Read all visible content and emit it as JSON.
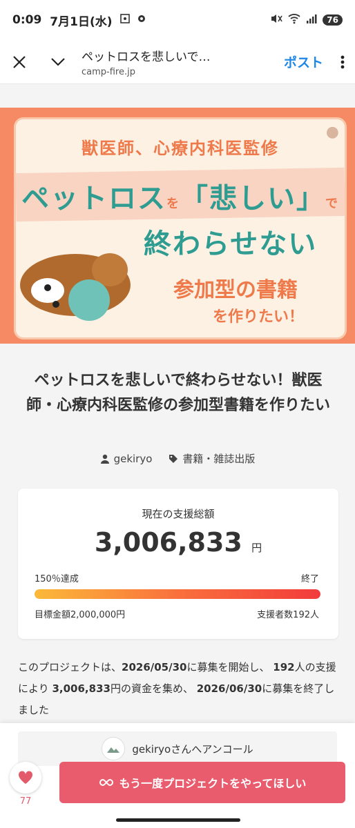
{
  "status_bar": {
    "time": "0:09",
    "date": "7月1日(水)",
    "battery": "76"
  },
  "browser": {
    "title": "ペットロスを悲しいで…",
    "url": "camp-fire.jp",
    "post_label": "ポスト"
  },
  "hero": {
    "subtitle": "獣医師、心療内科医監修",
    "line1a": "ペットロス",
    "line1b": "を",
    "line1c": "「悲しい」",
    "line1d": "で",
    "line2": "終わらせない",
    "line3": "参加型の書籍",
    "line4": "を作りたい！"
  },
  "project": {
    "title": "ペットロスを悲しいで終わらせない！獣医師・心療内科医監修の参加型書籍を作りたい",
    "owner": "gekiryo",
    "category": "書籍・雑誌出版"
  },
  "funding": {
    "label": "現在の支援総額",
    "amount": "3,006,833",
    "currency": "円",
    "percent_text": "150％達成",
    "percent": 150,
    "status": "終了",
    "goal_text": "目標金額2,000,000円",
    "backers_text": "支援者数192人"
  },
  "summary": {
    "p1": "このプロジェクトは、",
    "start": "2026/05/30",
    "p2": "に募集を開始し、",
    "backers": "192",
    "p3": "人の支援により",
    "amount": "3,006,833",
    "p4": "円の資金を集め、",
    "end": "2026/06/30",
    "p5": "に募集を終了しました"
  },
  "encore": {
    "label": "gekiryoさんへアンコール"
  },
  "like": {
    "count": "77"
  },
  "cta": {
    "label": "もう一度プロジェクトをやってほしい"
  }
}
